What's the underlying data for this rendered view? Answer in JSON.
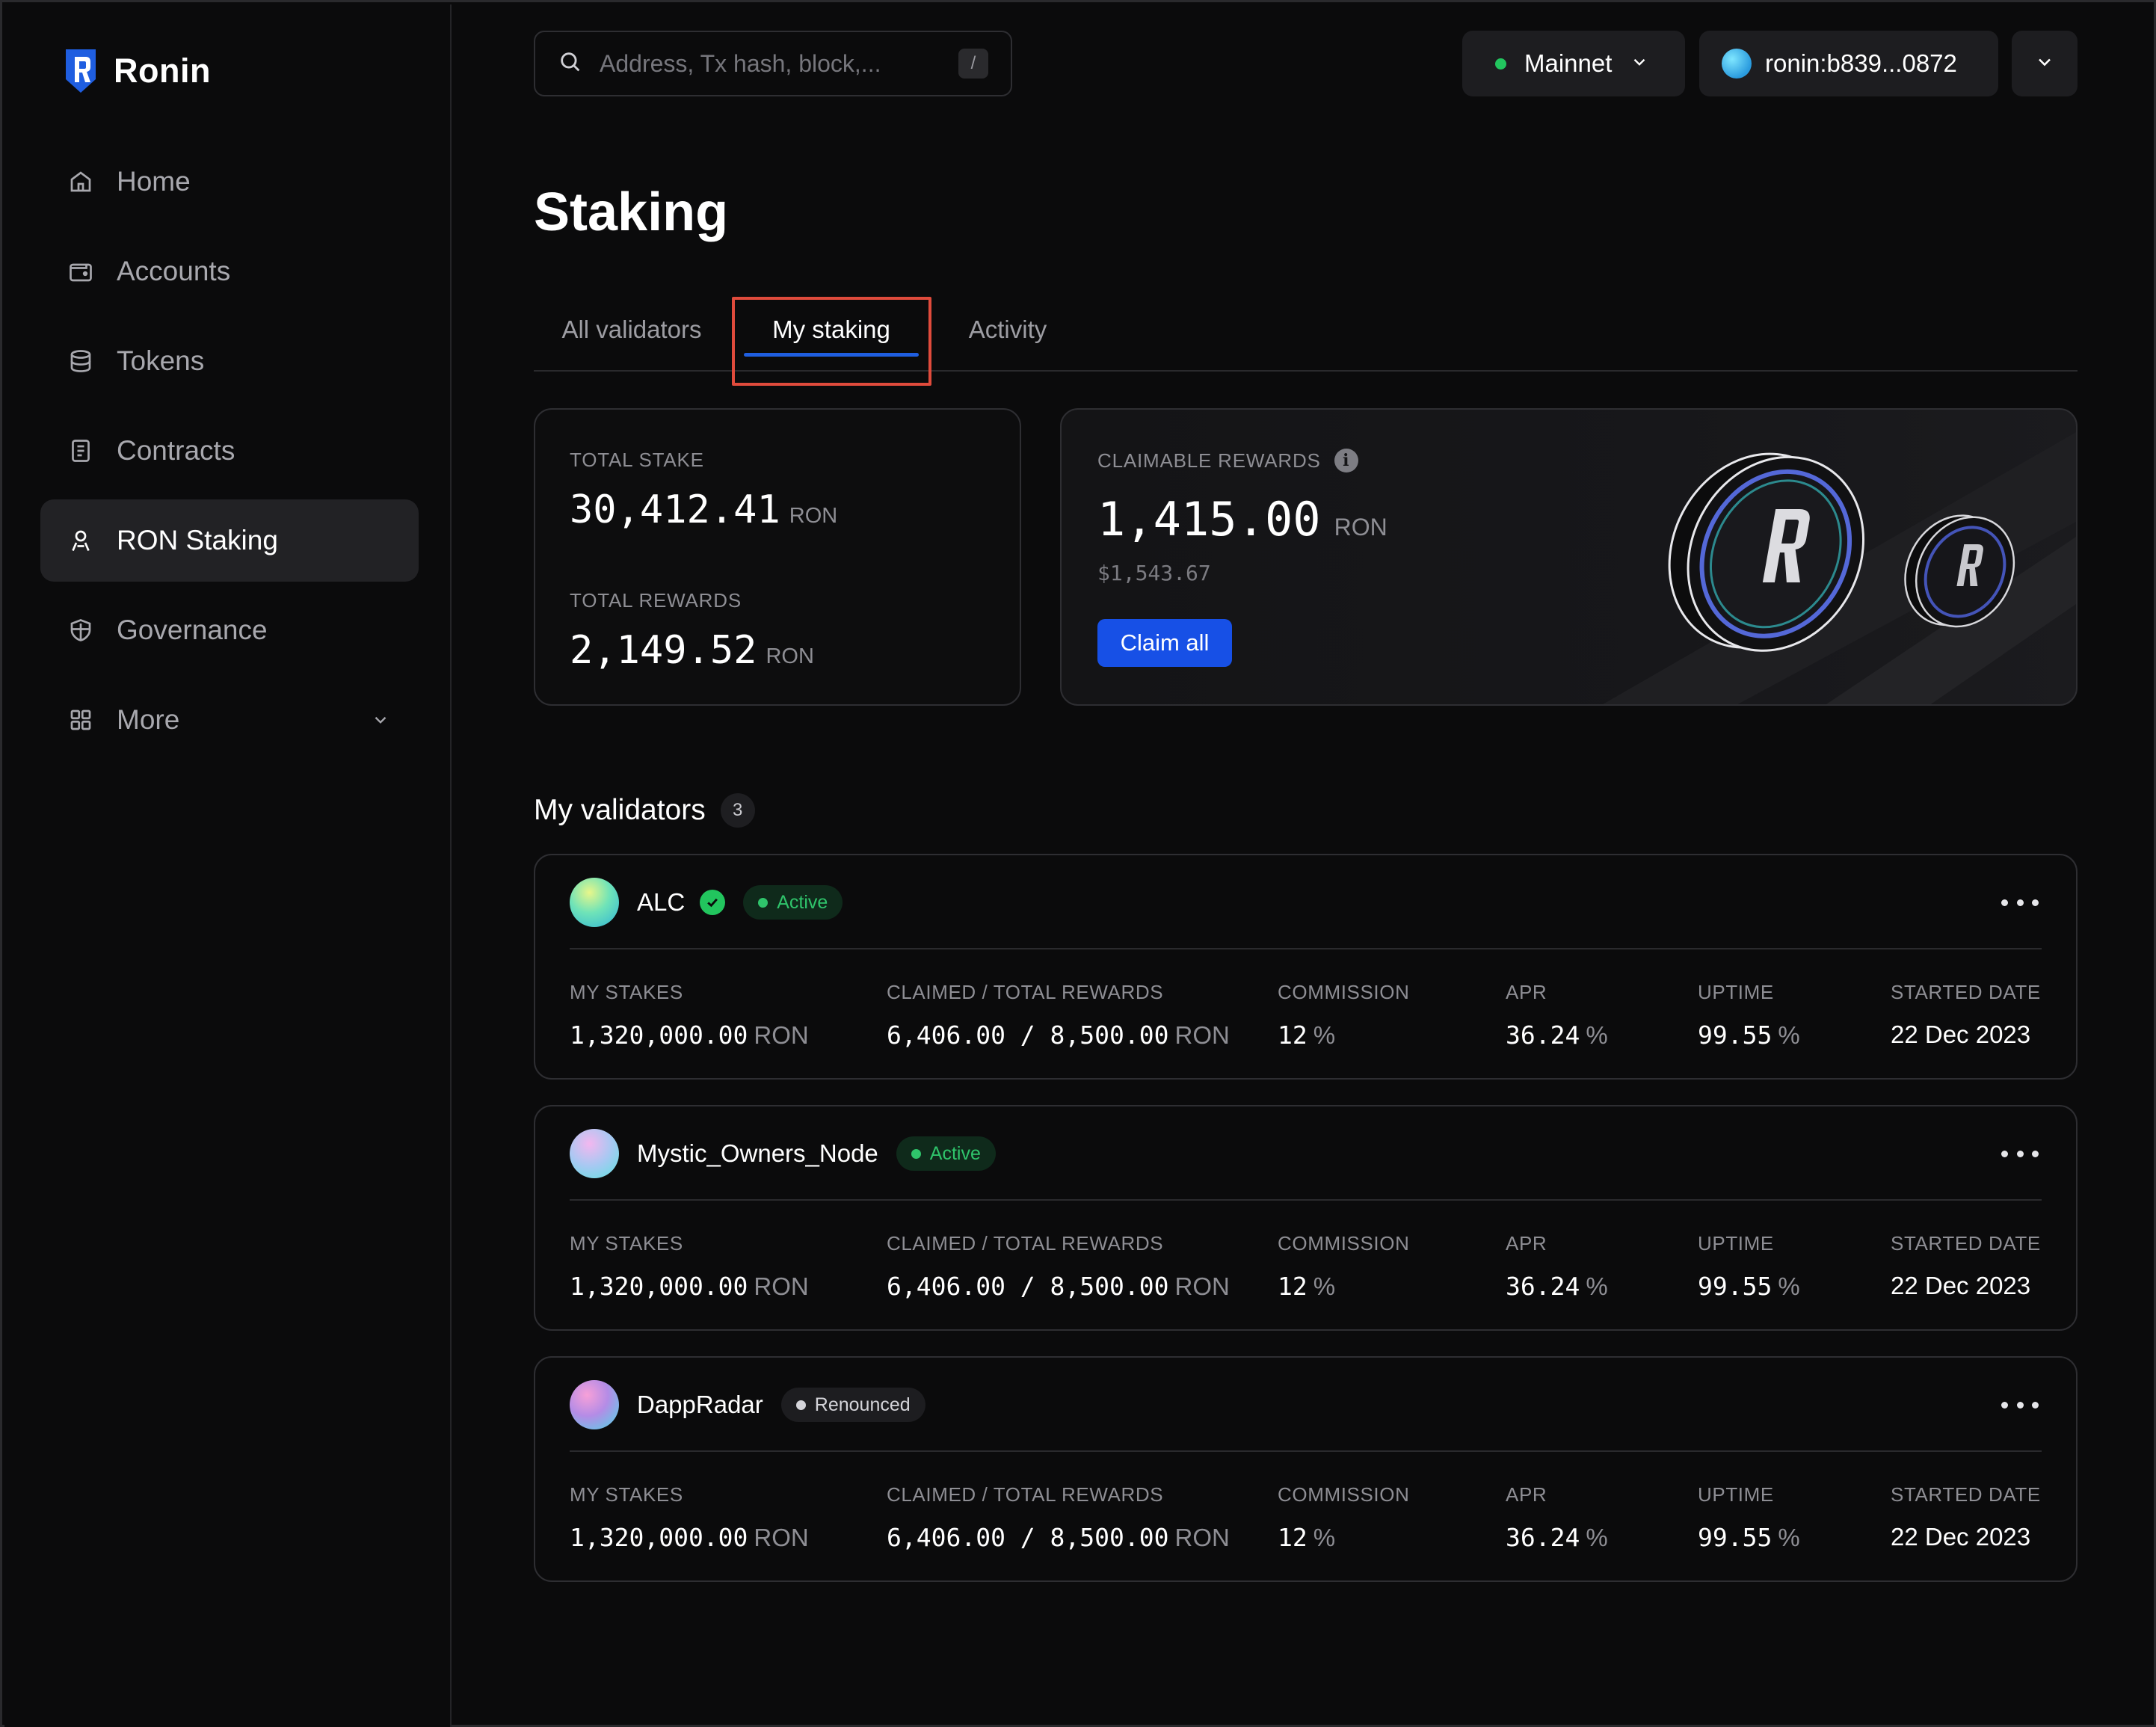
{
  "brand": {
    "name": "Ronin"
  },
  "sidebar": {
    "items": [
      {
        "label": "Home",
        "icon": "home-icon",
        "active": false
      },
      {
        "label": "Accounts",
        "icon": "wallet-icon",
        "active": false
      },
      {
        "label": "Tokens",
        "icon": "database-icon",
        "active": false
      },
      {
        "label": "Contracts",
        "icon": "document-icon",
        "active": false
      },
      {
        "label": "RON Staking",
        "icon": "staking-icon",
        "active": true
      },
      {
        "label": "Governance",
        "icon": "shield-icon",
        "active": false
      },
      {
        "label": "More",
        "icon": "grid-icon",
        "active": false
      }
    ]
  },
  "topbar": {
    "search": {
      "placeholder": "Address, Tx hash, block,...",
      "shortcut": "/"
    },
    "network": {
      "label": "Mainnet",
      "status_color": "#22c55e"
    },
    "wallet": {
      "label": "ronin:b839...0872"
    }
  },
  "page": {
    "title": "Staking",
    "tabs": [
      {
        "label": "All validators",
        "selected": false
      },
      {
        "label": "My staking",
        "selected": true
      },
      {
        "label": "Activity",
        "selected": false
      }
    ]
  },
  "summary": {
    "total_stake": {
      "label": "TOTAL STAKE",
      "value": "30,412.41",
      "unit": "RON"
    },
    "total_rewards": {
      "label": "TOTAL REWARDS",
      "value": "2,149.52",
      "unit": "RON"
    },
    "claimable": {
      "label": "CLAIMABLE REWARDS",
      "value": "1,415.00",
      "unit": "RON",
      "usd": "$1,543.67",
      "button": "Claim all"
    }
  },
  "validators": {
    "title": "My validators",
    "count": "3",
    "columns": [
      "MY STAKES",
      "CLAIMED / TOTAL REWARDS",
      "COMMISSION",
      "APR",
      "UPTIME",
      "STARTED DATE"
    ],
    "items": [
      {
        "name": "ALC",
        "verified": true,
        "status": "Active",
        "my_stakes": "1,320,000.00",
        "stakes_unit": "RON",
        "rewards": "6,406.00 / 8,500.00",
        "rewards_unit": "RON",
        "commission": "12",
        "apr": "36.24",
        "uptime": "99.55",
        "pct": "%",
        "started": "22 Dec 2023"
      },
      {
        "name": "Mystic_Owners_Node",
        "verified": false,
        "status": "Active",
        "my_stakes": "1,320,000.00",
        "stakes_unit": "RON",
        "rewards": "6,406.00 / 8,500.00",
        "rewards_unit": "RON",
        "commission": "12",
        "apr": "36.24",
        "uptime": "99.55",
        "pct": "%",
        "started": "22 Dec 2023"
      },
      {
        "name": "DappRadar",
        "verified": false,
        "status": "Renounced",
        "my_stakes": "1,320,000.00",
        "stakes_unit": "RON",
        "rewards": "6,406.00 / 8,500.00",
        "rewards_unit": "RON",
        "commission": "12",
        "apr": "36.24",
        "uptime": "99.55",
        "pct": "%",
        "started": "22 Dec 2023"
      }
    ]
  },
  "colors": {
    "accent": "#1750e6",
    "active_status": "#2fc46b",
    "highlight": "#e04b3c"
  }
}
